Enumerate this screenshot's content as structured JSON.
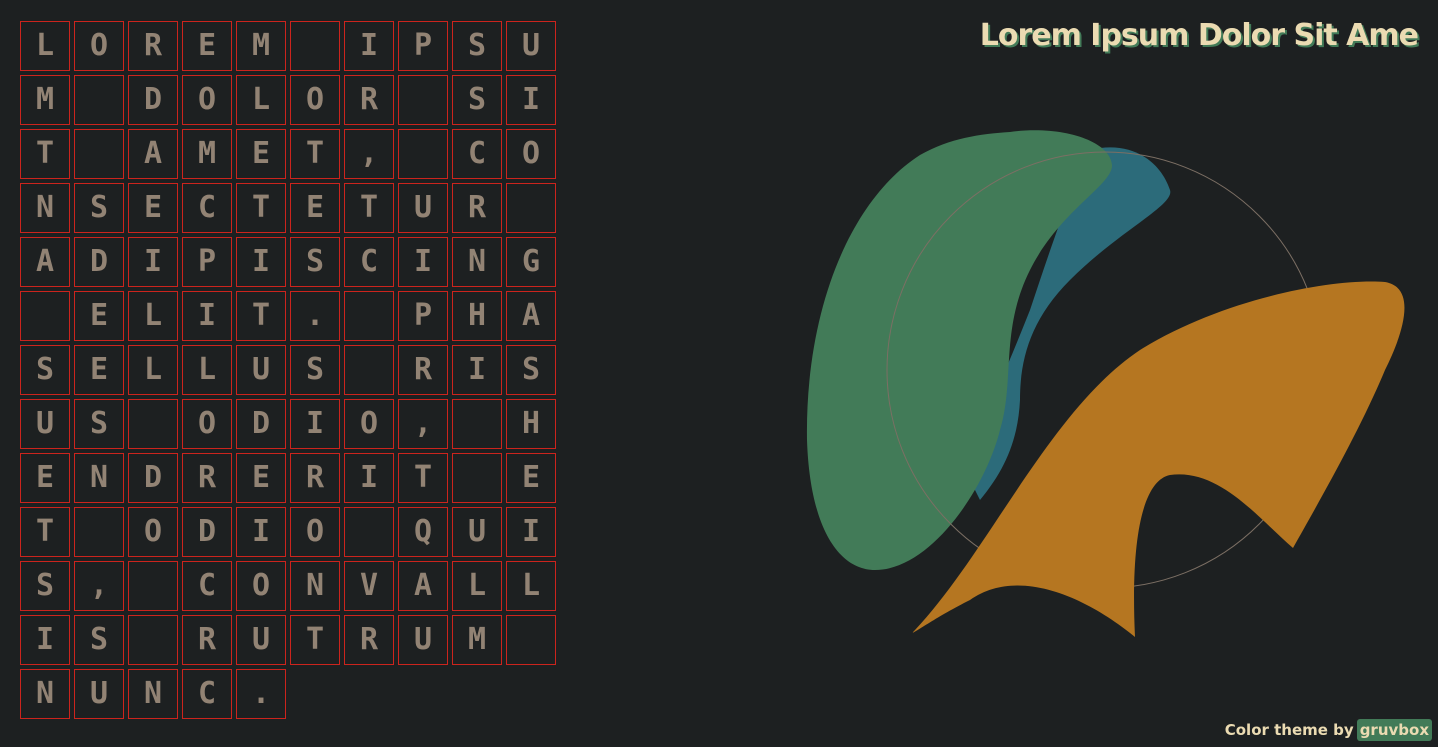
{
  "header": {
    "title": "Lorem Ipsum Dolor Sit Ame"
  },
  "letter_grid": {
    "columns": 10,
    "text": "LOREM IPSUM DOLOR SIT AMET, CONSECTETUR ADIPISCING ELIT. PHASELLUS RISUS ODIO, HENDRERIT ET ODIO QUIS, CONVALLIS RUTRUM NUNC."
  },
  "artwork": {
    "shapes": [
      {
        "name": "green-blob",
        "color": "#427b58"
      },
      {
        "name": "blue-blob",
        "color": "#2c6b7a"
      },
      {
        "name": "orange-arch",
        "color": "#b57621"
      },
      {
        "name": "outline-circle",
        "color": "#7c6f64"
      }
    ]
  },
  "footer": {
    "credit_text": "Color theme by",
    "credit_link": "gruvbox"
  },
  "colors": {
    "background": "#1d2021",
    "cell_border": "#cc241d",
    "letter": "#928374",
    "title": "#ebdbb2",
    "title_shadow": "#427b58"
  }
}
